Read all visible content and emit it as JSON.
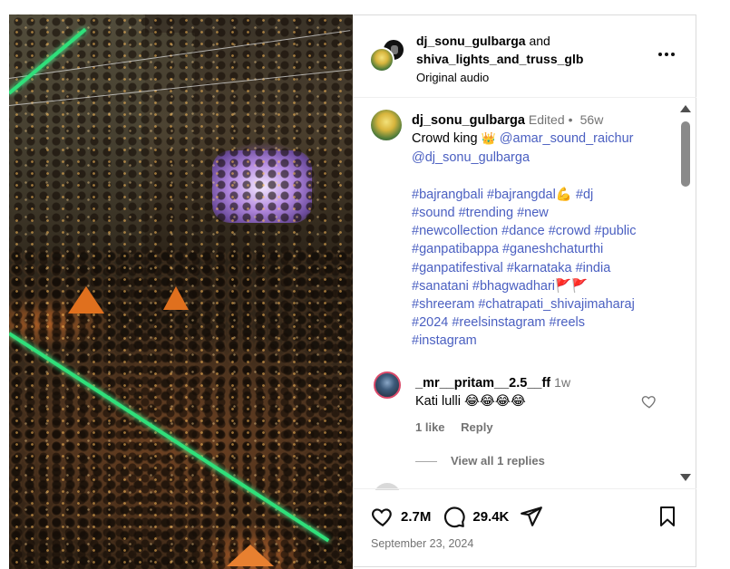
{
  "header": {
    "user1": "dj_sonu_gulbarga",
    "conjunction": "and",
    "user2": "shiva_lights_and_truss_glb",
    "audio": "Original audio"
  },
  "post": {
    "username": "dj_sonu_gulbarga",
    "edited": "Edited",
    "separator": "•",
    "age": "56w",
    "caption_text": "Crowd king",
    "caption_emoji": "👑",
    "mention1": "@amar_sound_raichur",
    "mention2": "@dj_sonu_gulbarga",
    "hashtag_lines": [
      "#bajrangbali #bajrangdal💪 #dj",
      "#sound #trending #new",
      "#newcollection #dance #crowd #public",
      "#ganpatibappa #ganeshchaturthi",
      "#ganpatifestival #karnataka #india",
      "#sanatani #bhagwadhari🚩🚩",
      "#shreeram #chatrapati_shivajimaharaj",
      "#2024 #reelsinstagram #reels",
      "#instagram"
    ]
  },
  "comment": {
    "username": "_mr__pritam__2.5__ff",
    "age": "1w",
    "text": "Kati lulli 😂😂😂😂",
    "likes": "1 like",
    "reply": "Reply",
    "view_replies": "View all 1 replies"
  },
  "footer": {
    "likes_count": "2.7M",
    "comments_count": "29.4K",
    "date": "September 23, 2024"
  },
  "colors": {
    "link": "#4a5fc1",
    "muted": "#737373",
    "border": "#dbdbdb"
  }
}
